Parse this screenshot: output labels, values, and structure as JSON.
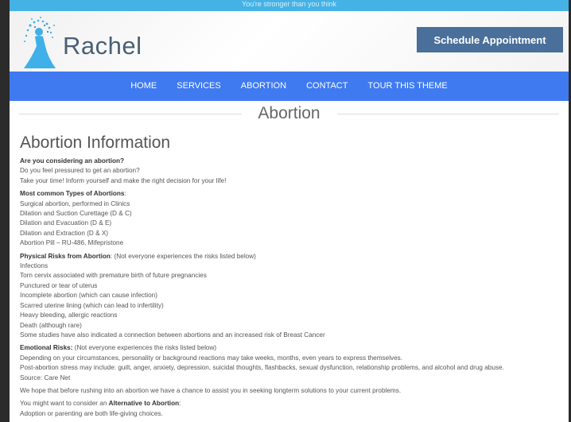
{
  "topbar": {
    "text": "You're stronger than you think"
  },
  "header": {
    "logo_text": "Rachel",
    "schedule_label": "Schedule Appointment"
  },
  "nav": {
    "items": [
      "HOME",
      "SERVICES",
      "ABORTION",
      "CONTACT",
      "TOUR THIS THEME"
    ]
  },
  "page_title": "Abortion",
  "section_title": "Abortion Information",
  "intro": {
    "heading": "Are you considering an abortion?",
    "lines": [
      "Do you feel pressured to get an abortion?",
      "Take your time! Inform yourself and make the right decision for your life!"
    ]
  },
  "types": {
    "heading": "Most common Types of Abortions",
    "lines": [
      "Surgical abortion, performed in Clinics",
      "Dilation and Suction Curettage (D & C)",
      "Dilation and Evacuation (D & E)",
      "Dilation and Extraction (D & X)",
      "Abortion Pill – RU-486, Mifepristone"
    ]
  },
  "physical": {
    "heading": "Physical Risks from Abortion",
    "note": " (Not everyone experiences the risks listed below)",
    "lines": [
      "Infections",
      "Torn cervix associated with premature birth of future pregnancies",
      "Punctured or tear of uterus",
      "Incomplete abortion (which can cause infection)",
      "Scarred uterine lining (which can lead to infertility)",
      "Heavy bleeding, allergic reactions",
      "Death (although rare)",
      "Some studies have also indicated a connection between abortions and an increased risk of Breast Cancer"
    ]
  },
  "emotional": {
    "heading": "Emotional Risks:",
    "note": " (Not everyone experiences the risks listed below)",
    "lines": [
      "Depending on your circumstances, personality or background reactions may take weeks, months, even years to express themselves.",
      "Post-abortion stress may include: guilt, anger, anxiety, depression, suicidal thoughts, flashbacks, sexual dysfunction, relationship problems, and alcohol and drug abuse.",
      "Source: Care Net"
    ]
  },
  "hope": "We hope that before rushing into an abortion we have a chance to assist you in seeking longterm solutions to your current problems.",
  "alternative": {
    "prefix": "You might want to consider an ",
    "bold": "Alternative to Abortion",
    "suffix": ":",
    "lines": [
      "Adoption or parenting are both life-giving choices."
    ]
  },
  "colors": {
    "topbar": "#45b2e6",
    "nav": "#3f7af0",
    "button": "#496f9a",
    "logo_figure": "#3fb0e8"
  }
}
